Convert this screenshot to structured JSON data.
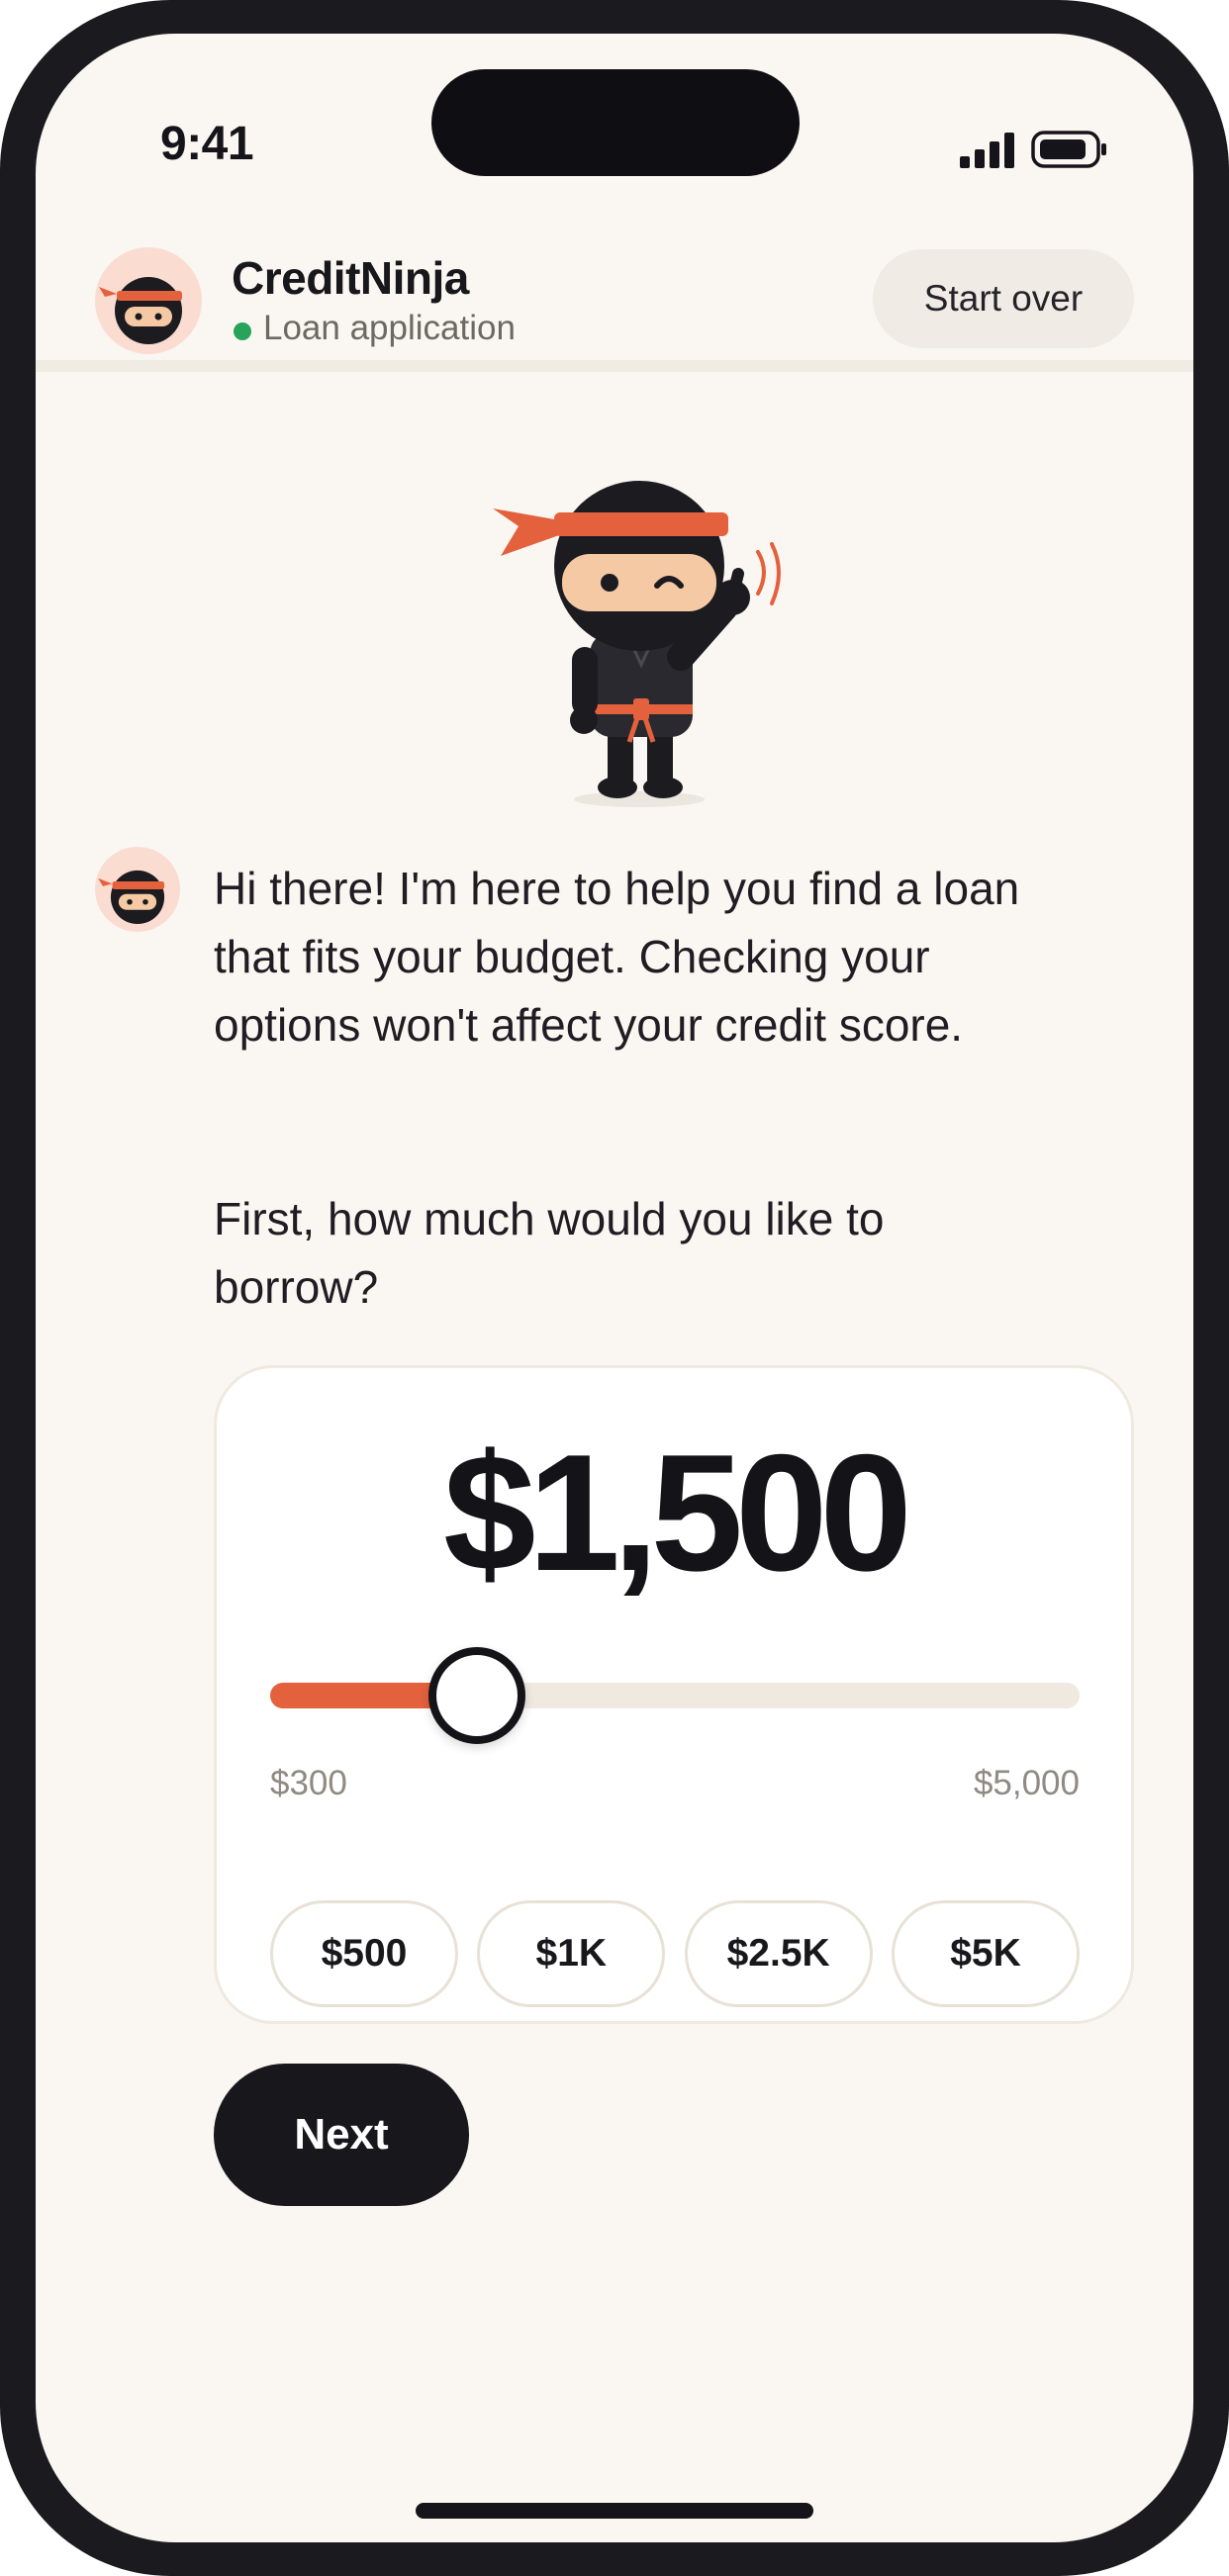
{
  "status_bar": {
    "time": "9:41",
    "signal_icon": "cellular-signal-icon",
    "battery_icon": "battery-icon"
  },
  "header": {
    "avatar_icon": "ninja-avatar-icon",
    "brand_name": "CreditNinja",
    "status_label": "Loan application",
    "status_color": "#27a35a",
    "start_over_label": "Start over"
  },
  "mascot_icon": "waving-ninja-mascot",
  "chat": {
    "bot_avatar_icon": "ninja-avatar-icon",
    "message": "Hi there! I'm here to help you find a loan that fits your budget. Checking your options won't affect your credit score.",
    "question": "First, how much would you like to borrow?"
  },
  "amount_selector": {
    "amount_display": "$1,500",
    "amount_value": 1500,
    "min_value": 300,
    "max_value": 5000,
    "min_label": "$300",
    "max_label": "$5,000",
    "accent_color": "#e4613d",
    "presets": [
      {
        "label": "$500"
      },
      {
        "label": "$1K"
      },
      {
        "label": "$2.5K"
      },
      {
        "label": "$5K"
      }
    ]
  },
  "next_label": "Next"
}
